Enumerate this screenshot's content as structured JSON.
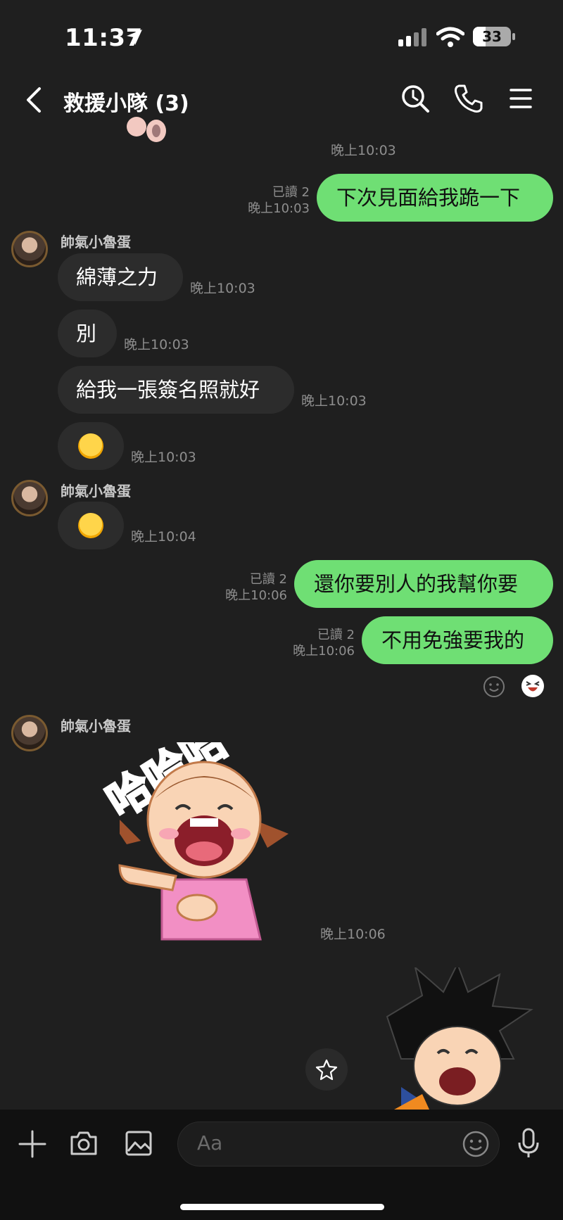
{
  "status_bar": {
    "time": "11:37",
    "battery": "33"
  },
  "header": {
    "title": "救援小隊 (3)"
  },
  "messages": {
    "ts_top": "晚上10:03",
    "out1": {
      "read": "已讀 2",
      "time": "晚上10:03",
      "text": "下次見面給我跪一下"
    },
    "sender1": "帥氣小魯蛋",
    "in1": {
      "text": "綿薄之力",
      "time": "晚上10:03"
    },
    "in2": {
      "text": "別",
      "time": "晚上10:03"
    },
    "in3": {
      "text": "給我一張簽名照就好",
      "time": "晚上10:03"
    },
    "in4": {
      "time": "晚上10:03"
    },
    "sender2": "帥氣小魯蛋",
    "in5": {
      "time": "晚上10:04"
    },
    "out2": {
      "read": "已讀 2",
      "time": "晚上10:06",
      "text": "還你要別人的我幫你要"
    },
    "out3": {
      "read": "已讀 2",
      "time": "晚上10:06",
      "text": "不用免強要我的"
    },
    "sender3": "帥氣小魯蛋",
    "sticker_text": "哈哈哈",
    "sticker_time": "晚上10:06"
  },
  "composer": {
    "placeholder": "Aa"
  },
  "colors": {
    "bubble_out": "#6fdf74",
    "bubble_in": "#2c2c2c",
    "background": "#1f1f1f"
  },
  "icons": [
    "back-icon",
    "search-icon",
    "phone-icon",
    "menu-icon",
    "plus-icon",
    "camera-icon",
    "image-icon",
    "emoji-icon",
    "mic-icon",
    "star-icon"
  ]
}
